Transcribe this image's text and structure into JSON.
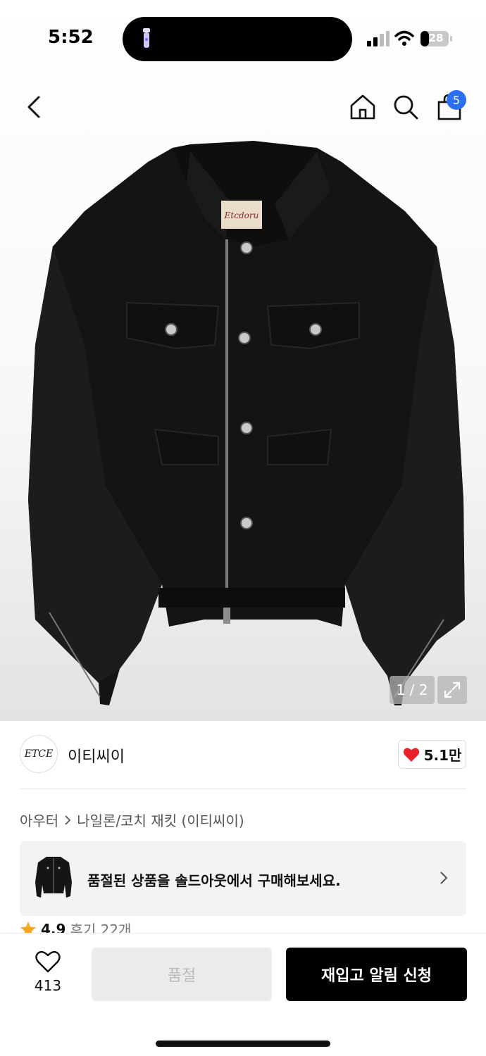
{
  "status_bar": {
    "time": "5:52",
    "battery": "28"
  },
  "nav": {
    "cart_count": "5"
  },
  "gallery": {
    "counter": "1 / 2"
  },
  "brand": {
    "logo_text": "ETCE",
    "name": "이티씨이",
    "likes": "5.1만"
  },
  "breadcrumb": {
    "category": "아우터",
    "subcategory": "나일론/코치 재킷 (이티씨이)"
  },
  "soldout_banner": {
    "text": "품절된 상품을 솔드아웃에서 구매해보세요."
  },
  "rating": {
    "score": "4.9",
    "reviews": "후기 22개"
  },
  "bottom_bar": {
    "wish_count": "413",
    "soldout_label": "품절",
    "restock_label": "재입고 알림 신청"
  },
  "colors": {
    "accent_blue": "#2b6ff2",
    "heart_red": "#e8202a",
    "star_orange": "#f5a623"
  }
}
